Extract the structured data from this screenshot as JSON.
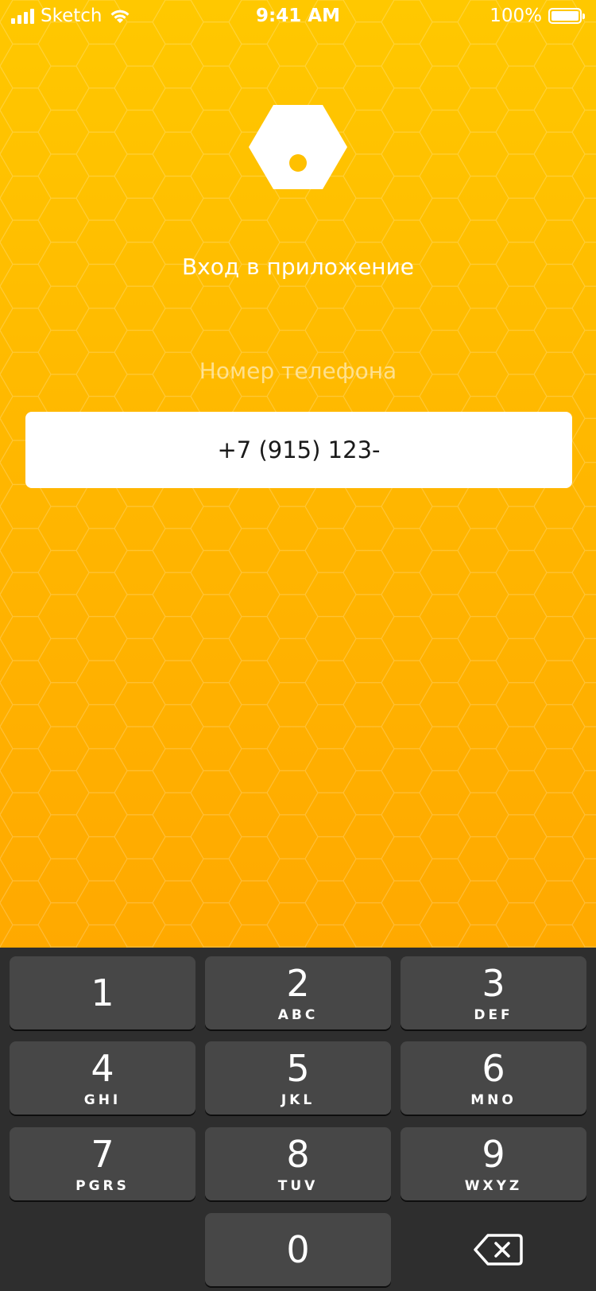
{
  "status_bar": {
    "carrier": "Sketch",
    "time": "9:41 AM",
    "battery": "100%"
  },
  "login": {
    "title": "Вход в приложение",
    "phone_label": "Номер телефона",
    "phone_value": "+7 (915) 123-"
  },
  "keypad": {
    "keys": [
      {
        "digit": "1",
        "letters": ""
      },
      {
        "digit": "2",
        "letters": "ABC"
      },
      {
        "digit": "3",
        "letters": "DEF"
      },
      {
        "digit": "4",
        "letters": "GHI"
      },
      {
        "digit": "5",
        "letters": "JKL"
      },
      {
        "digit": "6",
        "letters": "MNO"
      },
      {
        "digit": "7",
        "letters": "PGRS"
      },
      {
        "digit": "8",
        "letters": "TUV"
      },
      {
        "digit": "9",
        "letters": "WXYZ"
      },
      {
        "digit": "0",
        "letters": ""
      }
    ],
    "delete_icon": "backspace-icon"
  },
  "colors": {
    "background_top": "#ffc800",
    "background_bottom": "#ffa900",
    "keypad_bg": "#2e2e2e",
    "key_bg": "#474747"
  }
}
